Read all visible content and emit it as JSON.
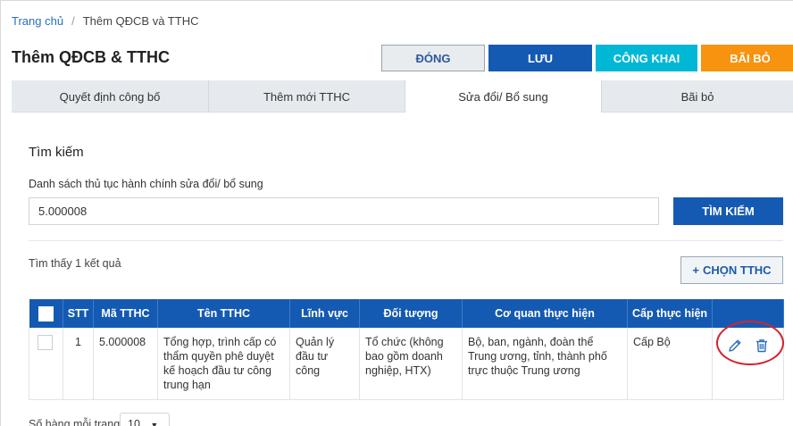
{
  "breadcrumb": {
    "home": "Trang chủ",
    "separator": "/",
    "current": "Thêm QĐCB và TTHC"
  },
  "page_title": "Thêm QĐCB & TTHC",
  "actions": {
    "close": "ĐÓNG",
    "save": "LƯU",
    "publish": "CÔNG KHAI",
    "cancel": "BÃI BỎ"
  },
  "tabs": [
    {
      "label": "Quyết định công bố"
    },
    {
      "label": "Thêm mới TTHC"
    },
    {
      "label": "Sửa đổi/ Bổ sung",
      "active": true
    },
    {
      "label": "Bãi bỏ"
    }
  ],
  "search": {
    "title": "Tìm kiếm",
    "field_label": "Danh sách thủ tục hành chính sửa đổi/ bổ sung",
    "value": "5.000008",
    "button": "TÌM KIẾM"
  },
  "results": {
    "count_text": "Tìm thấy 1 kết quả",
    "choose_button": "CHỌN TTHC",
    "choose_icon": "plus-icon"
  },
  "table": {
    "headers": [
      "STT",
      "Mã TTHC",
      "Tên TTHC",
      "Lĩnh vực",
      "Đối tượng",
      "Cơ quan thực hiện",
      "Cấp thực hiện"
    ],
    "rows": [
      {
        "stt": "1",
        "ma": "5.000008",
        "ten": "Tổng hợp, trình cấp có thẩm quyền phê duyệt kế hoạch đầu tư công trung hạn",
        "linh_vuc": "Quản lý đầu tư công",
        "doi_tuong": "Tổ chức (không bao gồm doanh nghiệp, HTX)",
        "co_quan": "Bộ, ban, ngành, đoàn thể Trung ương, tỉnh, thành phố trực thuộc Trung ương",
        "cap": "Cấp Bộ"
      }
    ],
    "row_action_icons": [
      "pencil-icon",
      "trash-icon"
    ]
  },
  "pagination": {
    "label": "Số hàng mỗi trang",
    "page_size": "10"
  },
  "colors": {
    "primary": "#155ab2",
    "publish": "#00b8d6",
    "cancel": "#f7930f",
    "highlight_ring": "#d1252e"
  }
}
